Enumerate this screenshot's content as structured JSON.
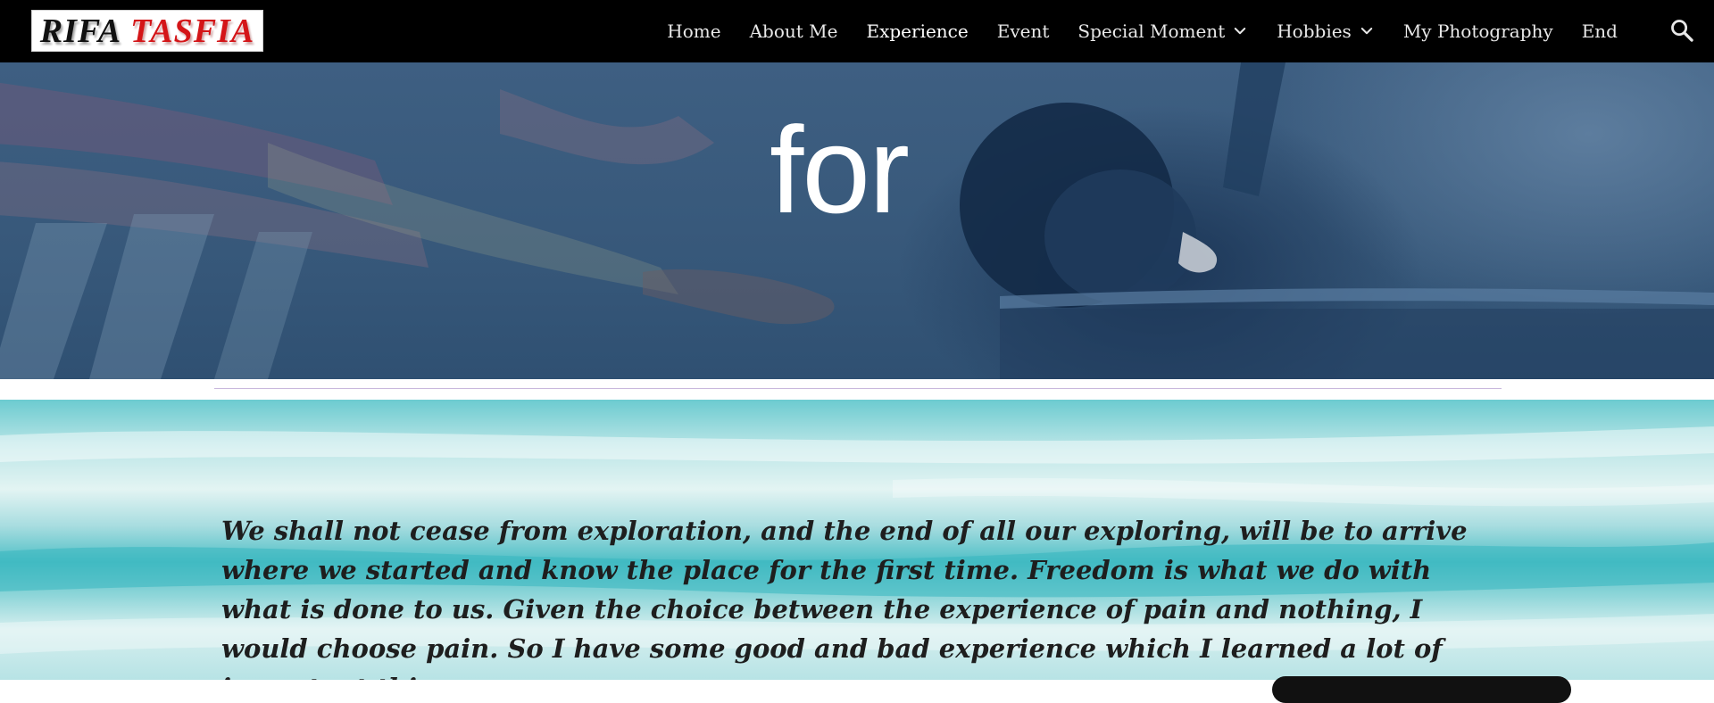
{
  "header": {
    "logo": {
      "part1": "RIFA",
      "part2": "TASFIA"
    },
    "nav": [
      {
        "label": "Home"
      },
      {
        "label": "About Me"
      },
      {
        "label": "Experience",
        "active": true
      },
      {
        "label": "Event"
      },
      {
        "label": "Special Moment",
        "has_dropdown": true
      },
      {
        "label": "Hobbies",
        "has_dropdown": true
      },
      {
        "label": "My Photography"
      },
      {
        "label": "End"
      }
    ],
    "search_icon": "search-icon"
  },
  "hero": {
    "visible_word": "for"
  },
  "quote": {
    "text": "We shall not cease from exploration, and the end of all our exploring, will be to arrive where we started and know the place for the first time. Freedom is what we do with what is done to us. Given the choice between the experience of pain and nothing, I would choose pain. So I have some good and bad experience which I learned a lot of important things"
  },
  "colors": {
    "nav_background": "#000000",
    "nav_text": "#e8e8e8",
    "logo_red": "#d41518",
    "hero_tint": "#3e5f82",
    "divider": "#c9b8dd",
    "quote_text": "#1e1e1e"
  }
}
